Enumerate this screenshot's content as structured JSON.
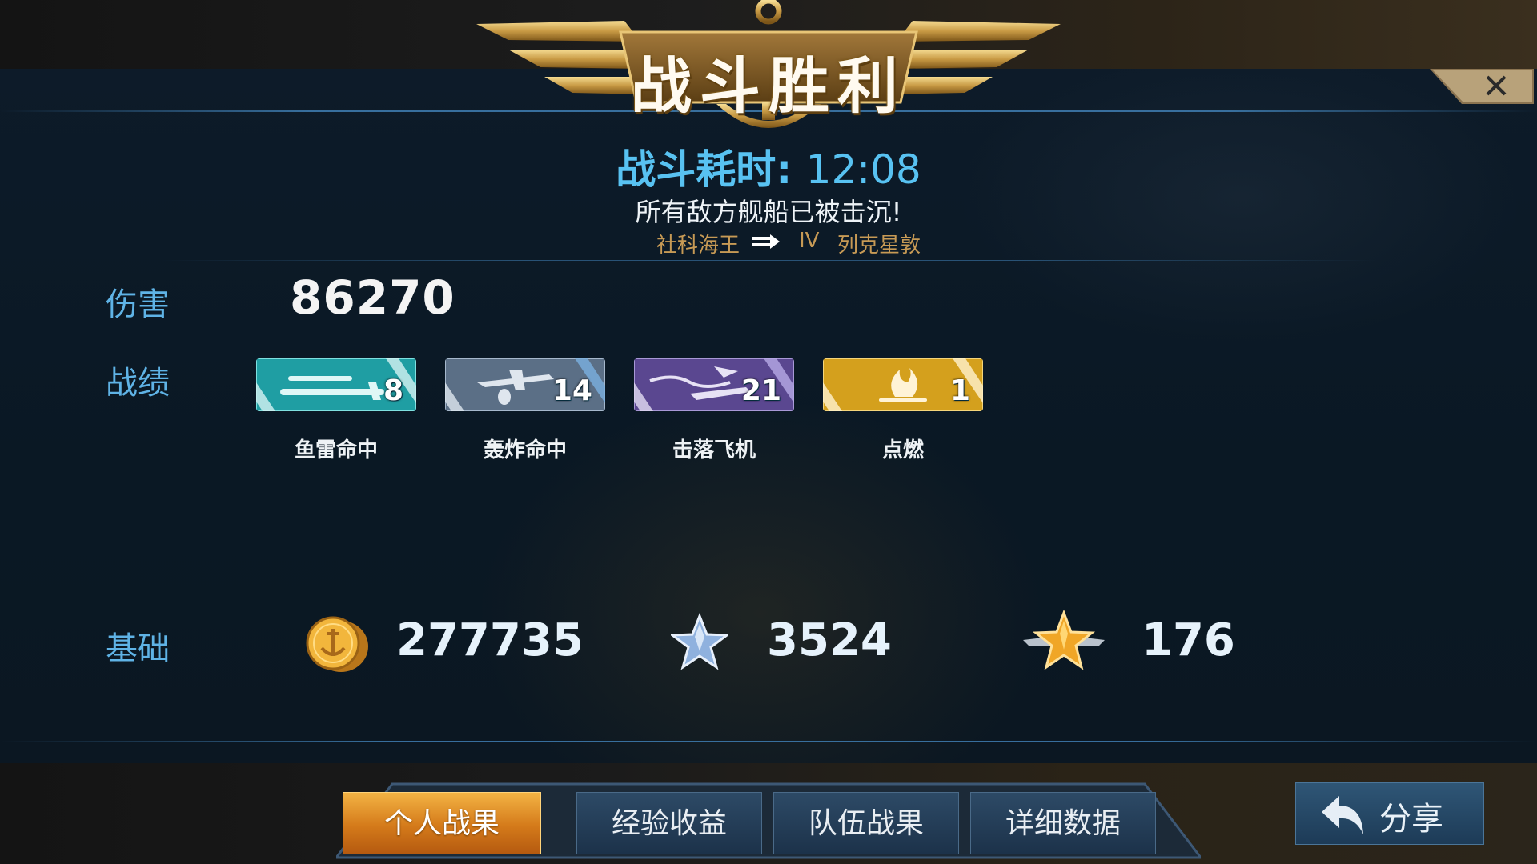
{
  "header": {
    "title": "战斗胜利",
    "duration_label": "战斗耗时:",
    "duration_value": "12:08",
    "subtitle": "所有敌方舰船已被击沉!",
    "ship_from": "社科海王",
    "ship_tier": "IV",
    "ship_to": "列克星敦"
  },
  "damage": {
    "label": "伤害",
    "value": "86270"
  },
  "record": {
    "label": "战绩",
    "badges": [
      {
        "label": "鱼雷命中",
        "count": "8",
        "icon": "torpedo-icon",
        "color": "#2aa6a8"
      },
      {
        "label": "轰炸命中",
        "count": "14",
        "icon": "bomber-icon",
        "color": "#5d7389"
      },
      {
        "label": "击落飞机",
        "count": "21",
        "icon": "plane-shotdown-icon",
        "color": "#5d4a92"
      },
      {
        "label": "点燃",
        "count": "1",
        "icon": "fire-icon",
        "color": "#d6a01e"
      }
    ]
  },
  "base": {
    "label": "基础",
    "items": [
      {
        "icon": "gold-coin-icon",
        "value": "277735"
      },
      {
        "icon": "silver-star-icon",
        "value": "3524"
      },
      {
        "icon": "winged-gold-star-icon",
        "value": "176"
      }
    ]
  },
  "tabs": [
    {
      "label": "个人战果",
      "active": true
    },
    {
      "label": "经验收益",
      "active": false
    },
    {
      "label": "队伍战果",
      "active": false
    },
    {
      "label": "详细数据",
      "active": false
    }
  ],
  "share": {
    "label": "分享"
  },
  "colors": {
    "accent_blue": "#58c2f2",
    "gold": "#d4a24a",
    "label_blue": "#5fb3e6"
  }
}
